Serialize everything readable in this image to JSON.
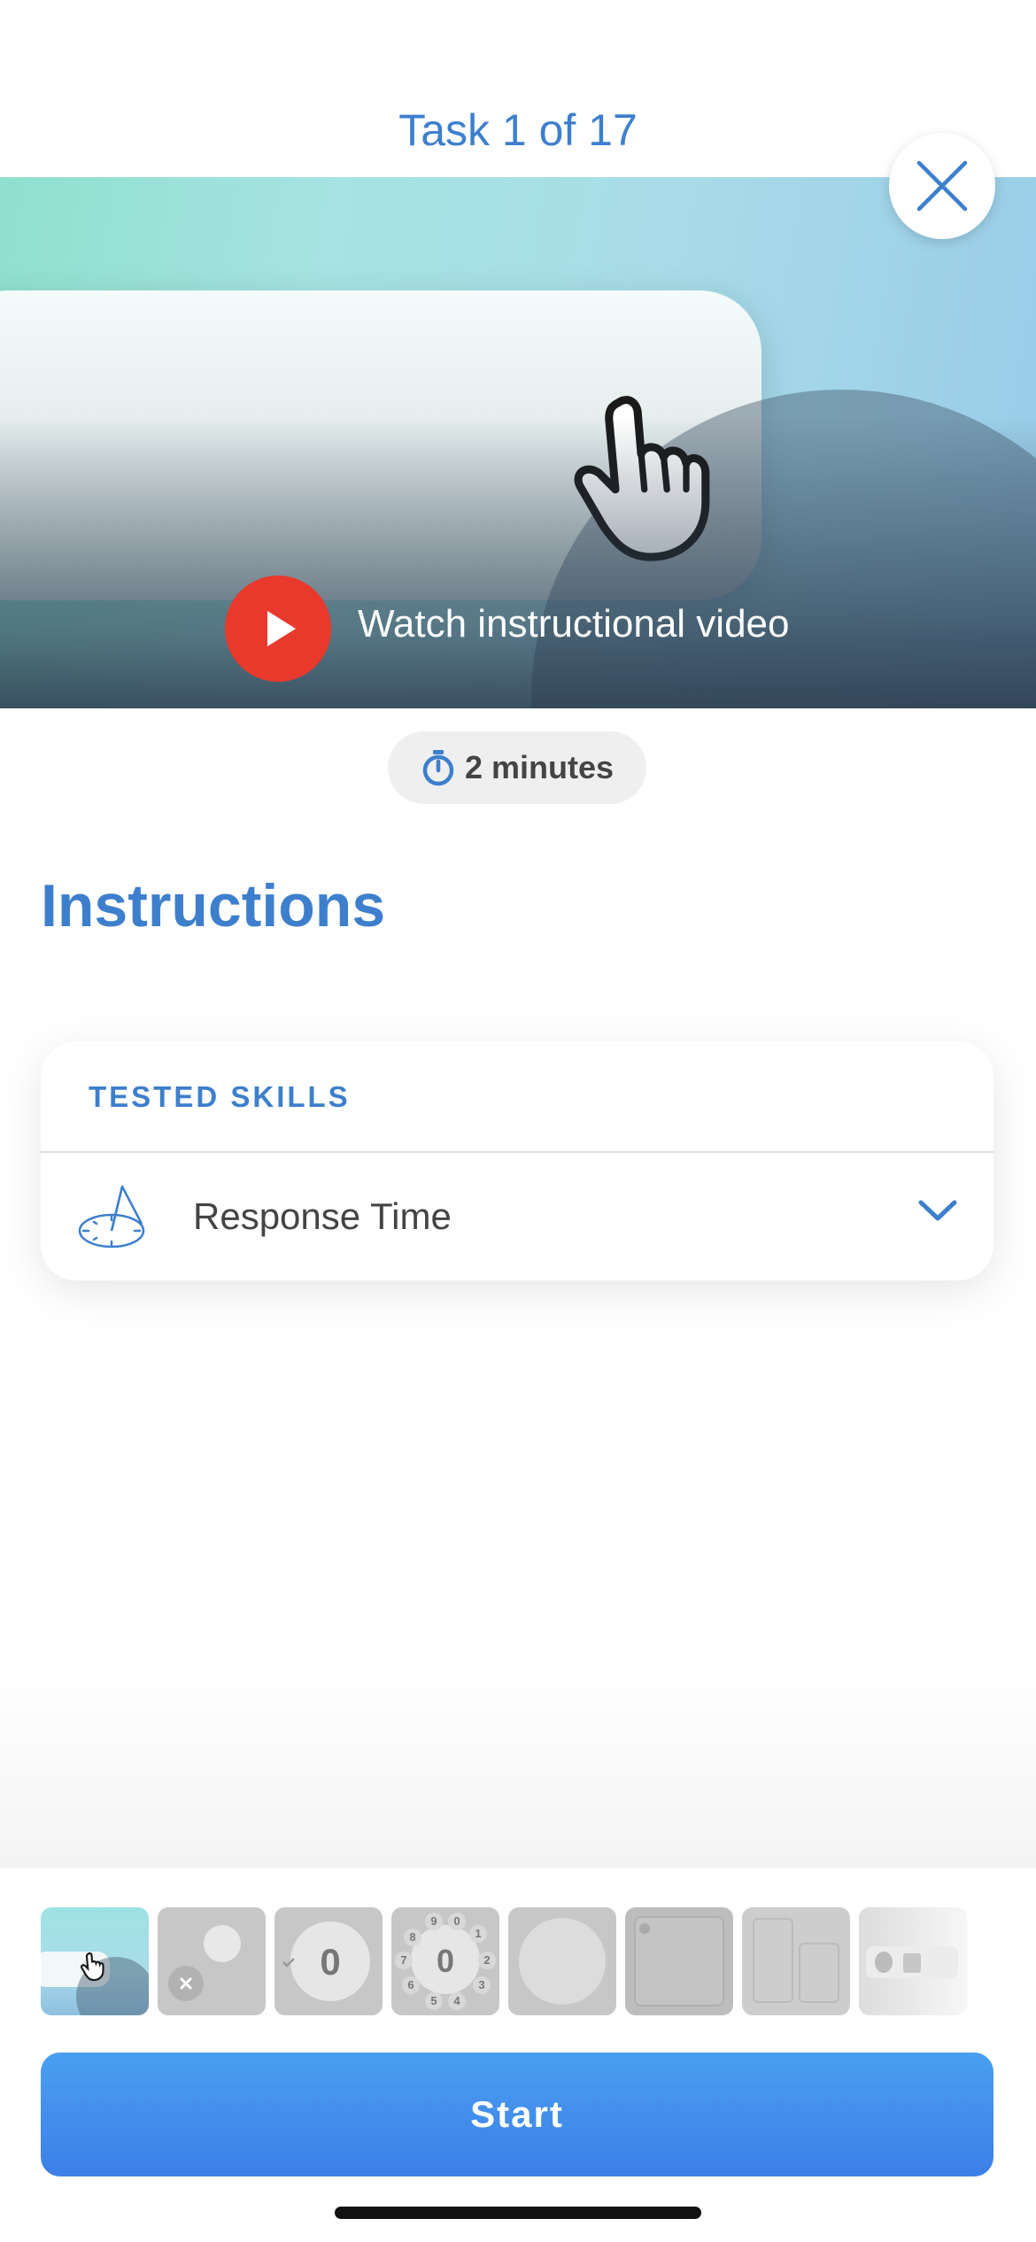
{
  "header": {
    "title": "Task 1 of 17"
  },
  "hero": {
    "video_label": "Watch instructional video"
  },
  "duration": {
    "label": "2 minutes"
  },
  "instructions": {
    "title": "Instructions"
  },
  "skills": {
    "header": "TESTED SKILLS",
    "items": [
      {
        "label": "Response Time",
        "icon": "sundial-icon"
      }
    ]
  },
  "thumbnails": {
    "count": 8,
    "selected_index": 0,
    "texts": {
      "counter": "0",
      "dial": [
        "9",
        "0",
        "1",
        "8",
        "2",
        "7",
        "3",
        "6",
        "5",
        "4"
      ]
    }
  },
  "footer": {
    "start_label": "Start"
  },
  "colors": {
    "accent": "#3d7fcd",
    "play": "#e8392c",
    "start_gradient_top": "#4a9ff0",
    "start_gradient_bottom": "#3c7fe8"
  }
}
